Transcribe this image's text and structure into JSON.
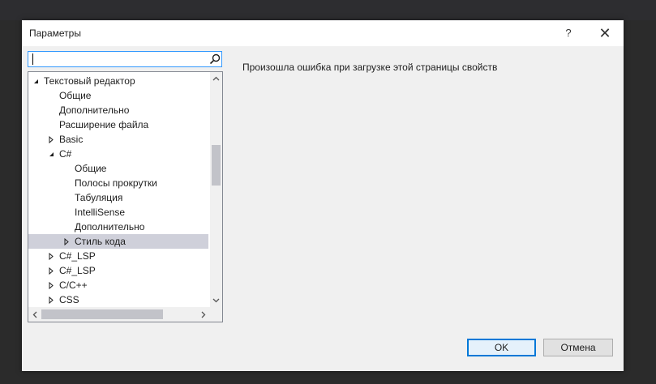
{
  "window": {
    "title": "Параметры",
    "help_glyph": "?",
    "close_glyph": "✕"
  },
  "search": {
    "value": "",
    "placeholder": ""
  },
  "tree": {
    "items": [
      {
        "label": "Текстовый редактор",
        "expander": "expanded",
        "level": 0
      },
      {
        "label": "Общие",
        "expander": "none",
        "level": 1
      },
      {
        "label": "Дополнительно",
        "expander": "none",
        "level": 1
      },
      {
        "label": "Расширение файла",
        "expander": "none",
        "level": 1
      },
      {
        "label": "Basic",
        "expander": "collapsed",
        "level": 1
      },
      {
        "label": "C#",
        "expander": "expanded",
        "level": 1
      },
      {
        "label": "Общие",
        "expander": "none",
        "level": 2
      },
      {
        "label": "Полосы прокрутки",
        "expander": "none",
        "level": 2
      },
      {
        "label": "Табуляция",
        "expander": "none",
        "level": 2
      },
      {
        "label": "IntelliSense",
        "expander": "none",
        "level": 2
      },
      {
        "label": "Дополнительно",
        "expander": "none",
        "level": 2
      },
      {
        "label": "Стиль кода",
        "expander": "collapsed",
        "level": 2,
        "selected": true
      },
      {
        "label": "C#_LSP",
        "expander": "collapsed",
        "level": 1
      },
      {
        "label": "C#_LSP",
        "expander": "collapsed",
        "level": 1
      },
      {
        "label": "C/C++",
        "expander": "collapsed",
        "level": 1
      },
      {
        "label": "CSS",
        "expander": "collapsed",
        "level": 1
      }
    ]
  },
  "content": {
    "error_message": "Произошла ошибка при загрузке этой страницы свойств"
  },
  "buttons": {
    "ok": "OK",
    "cancel": "Отмена"
  },
  "colors": {
    "selection": "#cfd0da",
    "accent": "#0078d7"
  }
}
